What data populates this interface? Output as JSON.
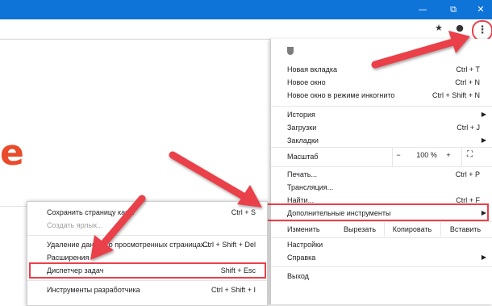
{
  "window": {
    "minimize": "—",
    "restore": "⧉",
    "close": "✕"
  },
  "toolbar": {
    "star_icon": "★",
    "profile_icon": "●",
    "menu_icon": "⋮"
  },
  "page": {
    "logo_letter": "e"
  },
  "main_menu": {
    "new_tab": {
      "label": "Новая вкладка",
      "shortcut": "Ctrl + T"
    },
    "new_window": {
      "label": "Новое окно",
      "shortcut": "Ctrl + N"
    },
    "incognito": {
      "label": "Новое окно в режиме инкогнито",
      "shortcut": "Ctrl + Shift + N"
    },
    "history": {
      "label": "История"
    },
    "downloads": {
      "label": "Загрузки",
      "shortcut": "Ctrl + J"
    },
    "bookmarks": {
      "label": "Закладки"
    },
    "zoom": {
      "label": "Масштаб",
      "minus": "−",
      "value": "100 %",
      "plus": "+",
      "fullscreen": "⛶"
    },
    "print": {
      "label": "Печать...",
      "shortcut": "Ctrl + P"
    },
    "cast": {
      "label": "Трансляция..."
    },
    "find": {
      "label": "Найти...",
      "shortcut": "Ctrl + F"
    },
    "more_tools": {
      "label": "Дополнительные инструменты"
    },
    "edit": {
      "label": "Изменить",
      "cut": "Вырезать",
      "copy": "Копировать",
      "paste": "Вставить"
    },
    "settings": {
      "label": "Настройки"
    },
    "help": {
      "label": "Справка"
    },
    "exit": {
      "label": "Выход"
    }
  },
  "sub_menu": {
    "save_page": {
      "label": "Сохранить страницу как...",
      "shortcut": "Ctrl + S"
    },
    "create_shortcut": {
      "label": "Создать ярлык..."
    },
    "clear_data": {
      "label": "Удаление данных о просмотренных страницах...",
      "shortcut": "Ctrl + Shift + Del"
    },
    "extensions": {
      "label": "Расширения"
    },
    "task_manager": {
      "label": "Диспетчер задач",
      "shortcut": "Shift + Esc"
    },
    "dev_tools": {
      "label": "Инструменты разработчика",
      "shortcut": "Ctrl + Shift + I"
    }
  },
  "colors": {
    "titlebar": "#0f74d8",
    "highlight": "#e9404a",
    "logo": "#ea4b2a"
  }
}
